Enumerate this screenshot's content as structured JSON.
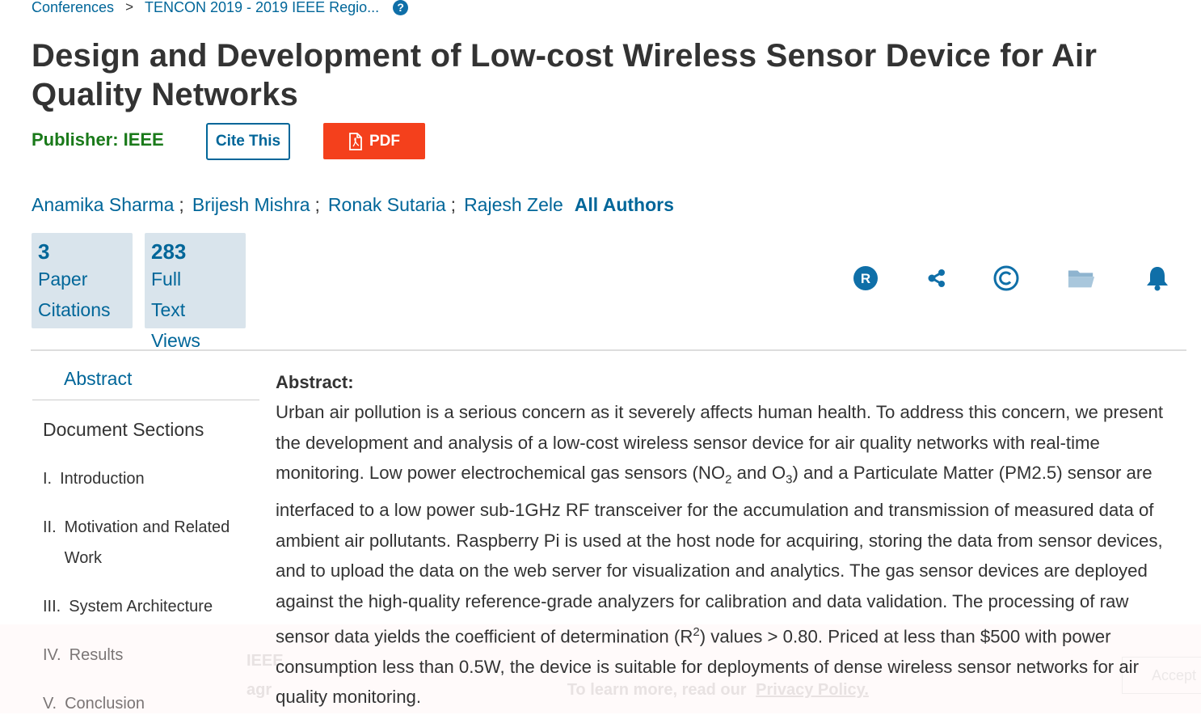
{
  "breadcrumb": {
    "items": [
      "Conferences",
      "TENCON 2019 - 2019 IEEE Regio..."
    ],
    "separator": ">",
    "help_icon": "?"
  },
  "title": "Design and Development of Low-cost Wireless Sensor Device for Air Quality Networks",
  "publisher": {
    "label": "Publisher:",
    "value": "IEEE"
  },
  "buttons": {
    "cite": "Cite This",
    "pdf": "PDF"
  },
  "authors": [
    "Anamika Sharma",
    "Brijesh Mishra",
    "Ronak Sutaria",
    "Rajesh Zele"
  ],
  "author_separator": ";",
  "all_authors": "All Authors",
  "metrics": [
    {
      "value": "3",
      "label_line1": "Paper",
      "label_line2": "Citations"
    },
    {
      "value": "283",
      "label_line1": "Full",
      "label_line2": "Text Views"
    }
  ],
  "action_icons": [
    "rights-icon",
    "share-icon",
    "copyright-icon",
    "folder-icon",
    "alert-bell-icon"
  ],
  "nav": {
    "abstract": "Abstract",
    "heading": "Document Sections",
    "sections": [
      {
        "num": "I.",
        "label": "Introduction"
      },
      {
        "num": "II.",
        "label": "Motivation and Related",
        "label2": "Work"
      },
      {
        "num": "III.",
        "label": "System Architecture"
      },
      {
        "num": "IV.",
        "label": "Results"
      },
      {
        "num": "V.",
        "label": "Conclusion"
      }
    ]
  },
  "abstract": {
    "heading": "Abstract:",
    "part1": "Urban air pollution is a serious concern as it severely affects human health. To address this concern, we present the development and analysis of a low-cost wireless sensor device for air quality networks with real-time monitoring. Low power electrochemical gas sensors (NO",
    "sub1": "2",
    "part2": " and O",
    "sub2": "3",
    "part3": ") and a Particulate Matter (PM2.5) sensor are interfaced to a low power sub-1GHz RF transceiver for the accumulation and transmission of measured data of ambient air pollutants. Raspberry Pi is used at the host node for acquiring, storing the data from sensor devices, and to upload the data on the web server for visualization and analytics. The gas sensor devices are deployed against the high-quality reference-grade analyzers for calibration and data validation. The processing of raw sensor data yields the coefficient of determination (R",
    "sup1": "2",
    "part4": ") values > 0.80. Priced at less than $500 with power consumption less than 0.5W, the device is suitable for deployments of dense wireless sensor networks for air quality monitoring."
  },
  "cookie_banner": {
    "line1": "IEEE",
    "line2_start": "agr",
    "line2_text": "To learn more, read our",
    "link": "Privacy Policy.",
    "accept": "Accept"
  },
  "colors": {
    "link": "#006699",
    "publisher": "#1a7a1a",
    "pdf": "#f4401c",
    "metric_bg": "#d9e4ec"
  }
}
